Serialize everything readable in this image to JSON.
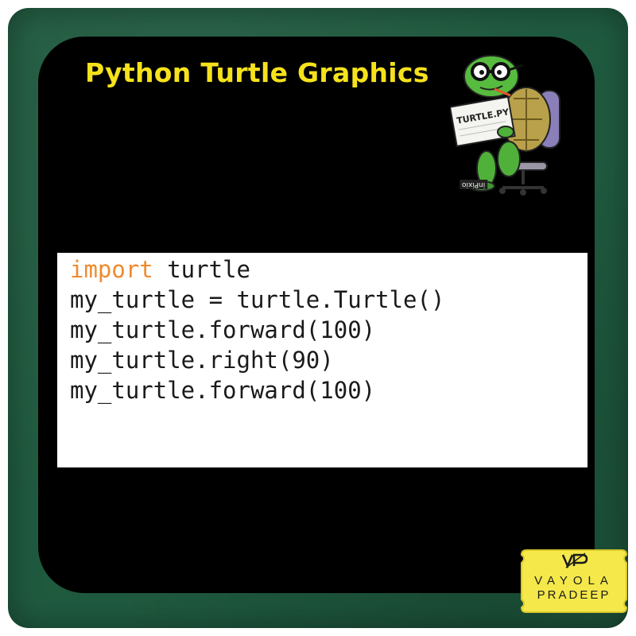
{
  "title": "Python Turtle Graphics",
  "mascot": {
    "icon": "turtle-mascot-icon",
    "sign_text": "TURTLE.PY",
    "watermark": "inPixio"
  },
  "code": {
    "language": "python",
    "lines": [
      {
        "keyword": "import",
        "rest": " turtle"
      },
      {
        "keyword": "",
        "rest": "my_turtle = turtle.Turtle()"
      },
      {
        "keyword": "",
        "rest": "my_turtle.forward(100)"
      },
      {
        "keyword": "",
        "rest": "my_turtle.right(90)"
      },
      {
        "keyword": "",
        "rest": "my_turtle.forward(100)"
      }
    ],
    "keyword_color": "#f08a2c",
    "text_color": "#1a1a1a"
  },
  "badge": {
    "logo": "VP",
    "line1": "VAYOLA",
    "line2": "PRADEEP",
    "background": "#f4e84a"
  },
  "colors": {
    "board": "#1f5a3f",
    "panel": "#000000",
    "title": "#f6e21b"
  }
}
